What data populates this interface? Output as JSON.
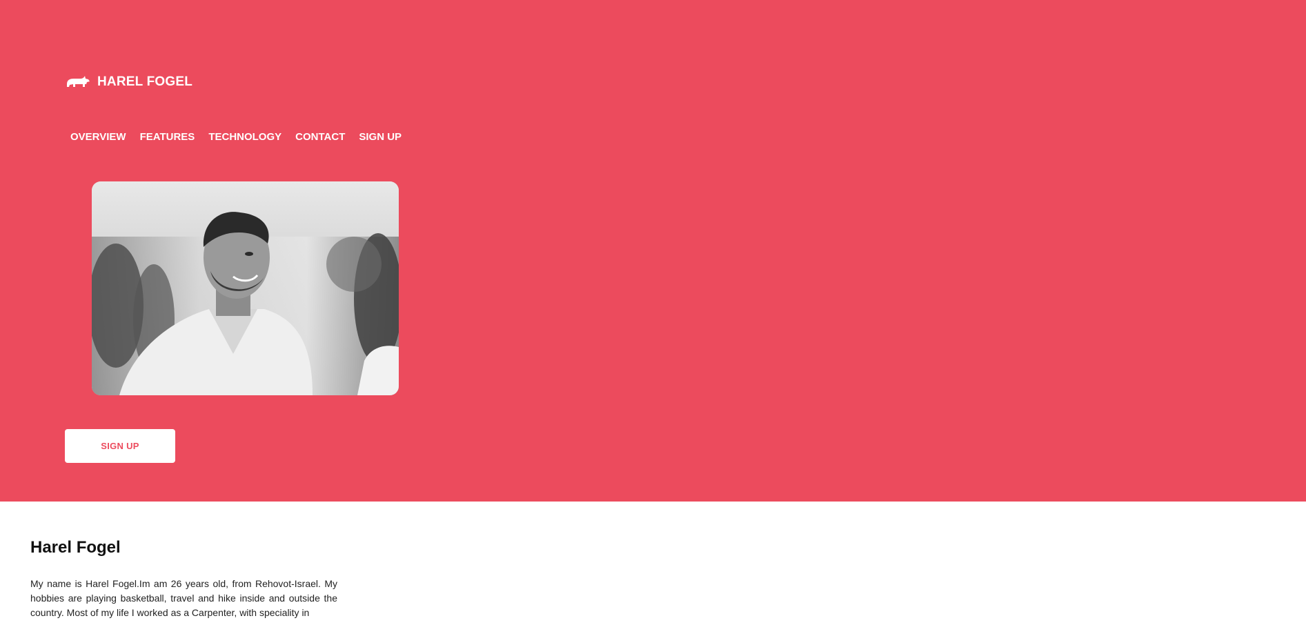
{
  "colors": {
    "accent": "#ec4b5d",
    "hero_text": "#ffffff",
    "body_text": "#222222"
  },
  "brand": {
    "logo_icon": "rhino-icon",
    "name": "HAREL FOGEL"
  },
  "nav": {
    "items": [
      {
        "label": "OVERVIEW"
      },
      {
        "label": "FEATURES"
      },
      {
        "label": "TECHNOLOGY"
      },
      {
        "label": "CONTACT"
      },
      {
        "label": "SIGN UP"
      }
    ]
  },
  "hero": {
    "photo_icon": "portrait-photo",
    "signup_label": "SIGN UP"
  },
  "about": {
    "title": "Harel Fogel",
    "text": "My name is Harel Fogel.Im am 26 years old, from Rehovot-Israel. My hobbies are playing basketball, travel and hike inside and outside the country. Most of my life I worked as a Carpenter, with speciality in"
  }
}
